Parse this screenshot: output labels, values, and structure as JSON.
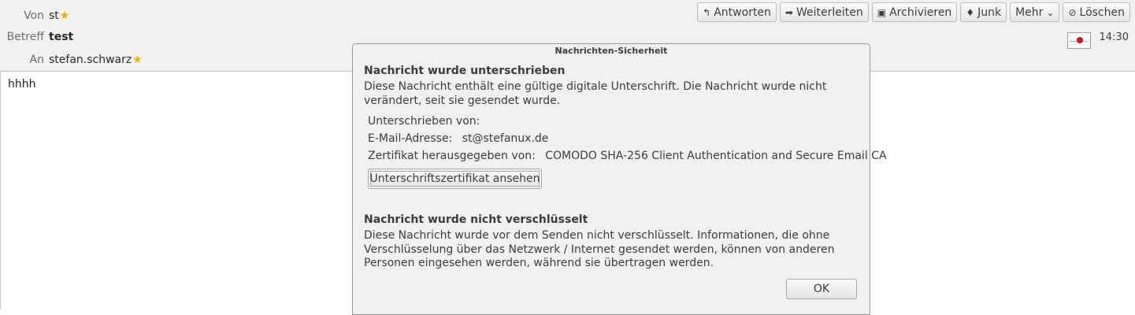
{
  "header": {
    "from_label": "Von",
    "from_value": "st",
    "subject_label": "Betreff",
    "subject_value": "test",
    "to_label": "An",
    "to_value": "stefan.schwarz",
    "time": "14:30"
  },
  "toolbar": {
    "reply": "Antworten",
    "forward": "Weiterleiten",
    "archive": "Archivieren",
    "junk": "Junk",
    "more": "Mehr",
    "delete": "Löschen"
  },
  "message": {
    "body": "hhhh"
  },
  "dialog": {
    "title": "Nachrichten-Sicherheit",
    "signed_heading": "Nachricht wurde unterschrieben",
    "signed_text": "Diese Nachricht enthält eine gültige digitale Unterschrift. Die Nachricht wurde nicht verändert, seit sie gesendet wurde.",
    "signed_by_label": "Unterschrieben von:",
    "email_label": "E-Mail-Adresse:",
    "email_value": "st@stefanux.de",
    "issuer_label": "Zertifikat herausgegeben von:",
    "issuer_value": "COMODO SHA-256 Client Authentication and Secure Email CA",
    "view_cert_button": "Unterschriftszertifikat ansehen",
    "encrypted_heading": "Nachricht wurde nicht verschlüsselt",
    "encrypted_text": "Diese Nachricht wurde vor dem Senden nicht verschlüsselt. Informationen, die ohne Verschlüsselung über das Netzwerk / Internet gesendet werden, können von anderen Personen eingesehen werden, während sie übertragen werden.",
    "ok_button": "OK"
  },
  "colors": {
    "star": "#e8b000",
    "seal": "#c8102e",
    "header_bg": "#f2f1f0"
  }
}
